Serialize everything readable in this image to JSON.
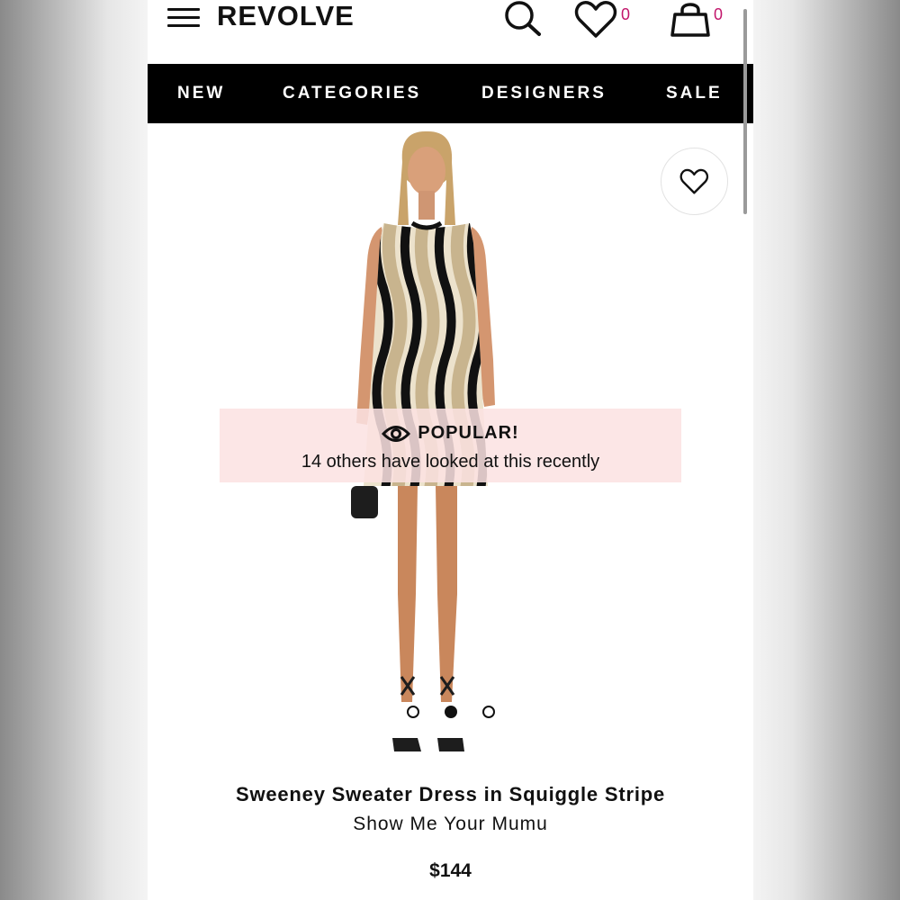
{
  "header": {
    "logo": "REVOLVE",
    "wishlist_count": "0",
    "cart_count": "0",
    "icons": [
      "hamburger-menu-icon",
      "search-icon",
      "heart-icon",
      "shopping-bag-icon"
    ]
  },
  "nav": {
    "items": [
      {
        "label": "NEW"
      },
      {
        "label": "CATEGORIES"
      },
      {
        "label": "DESIGNERS"
      },
      {
        "label": "SALE"
      }
    ]
  },
  "product": {
    "image_alt": "Model wearing black and beige squiggle stripe sleeveless sweater dress",
    "popular": {
      "title": "POPULAR!",
      "subtitle": "14 others have looked at this recently"
    },
    "carousel": {
      "count": 3,
      "active_index": 1
    },
    "name": "Sweeney Sweater Dress in Squiggle Stripe",
    "brand": "Show Me Your Mumu",
    "price": "$144"
  },
  "colors": {
    "navbar_bg": "#000000",
    "badge": "#c2166b",
    "popular_bg": "#fbe2e2"
  }
}
